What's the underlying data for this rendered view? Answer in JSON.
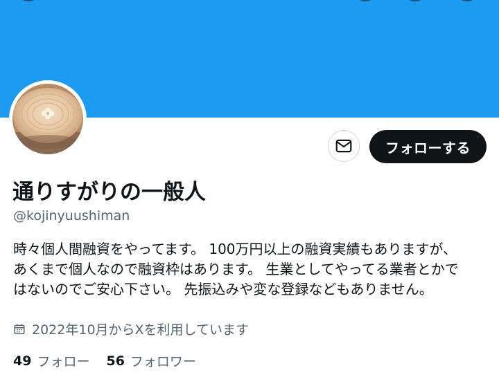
{
  "profile": {
    "display_name": "通りすがりの一般人",
    "handle": "@kojinyuushiman",
    "bio_lines": [
      "時々個人間融資をやってます。 100万円以上の融資実績もありますが、",
      "あくまで個人なので融資枠はあります。 生業としてやってる業者とかで",
      "はないのでご安心下さい。 先振込みや変な登録などもありません。"
    ],
    "joined": "2022年10月からXを利用しています",
    "following_count": "49",
    "following_label": "フォロー",
    "followers_count": "56",
    "followers_label": "フォロワー"
  },
  "actions": {
    "follow_label": "フォローする",
    "message_icon": "envelope-icon"
  },
  "icons": {
    "calendar": "calendar-icon"
  },
  "colors": {
    "banner": "#1d9bf0",
    "follow_button": "#0f1419",
    "secondary_text": "#536471"
  }
}
